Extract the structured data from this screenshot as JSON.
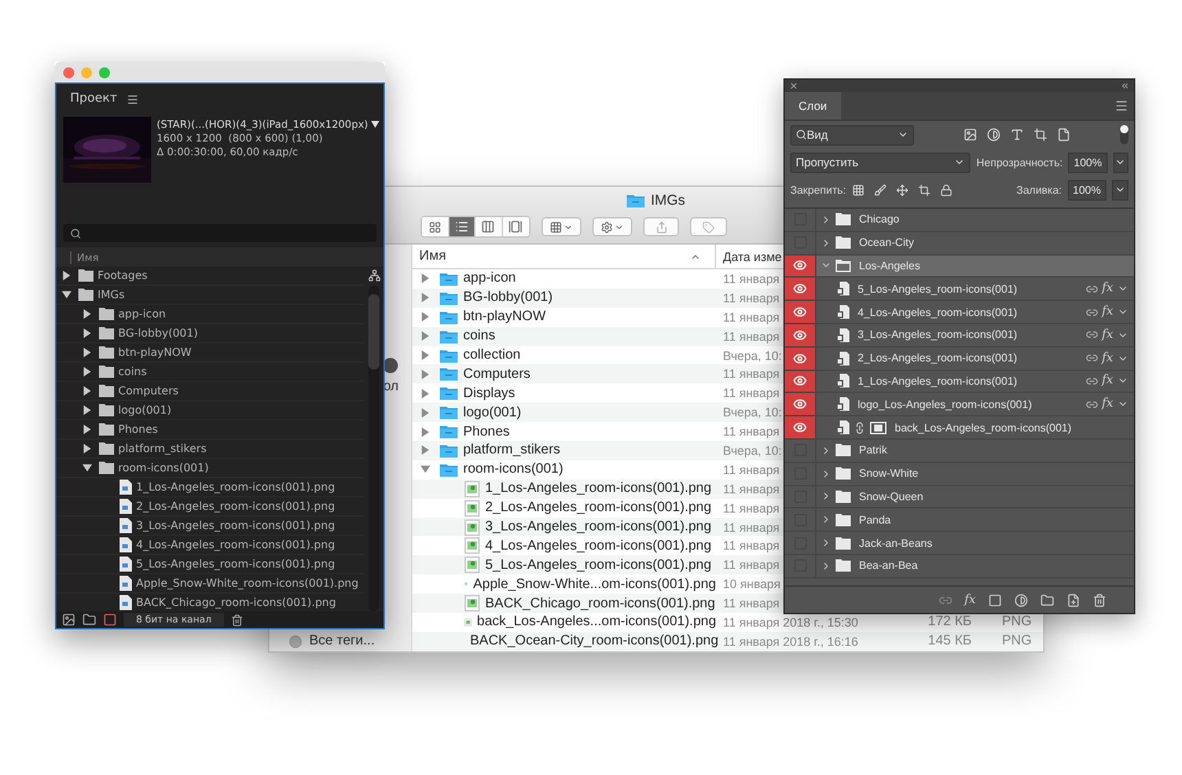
{
  "project_panel": {
    "title": "Проект",
    "comp": {
      "name": "(STAR)(...(HOR)(4_3)(iPad_1600x1200px)",
      "size": "1600 x 1200  (800 x 600) (1,00)",
      "duration": "Δ 0:00:30:00, 60,00 кадр/с"
    },
    "column": "Имя",
    "tree": [
      {
        "name": "Footages",
        "kind": "folder",
        "expanded": false
      },
      {
        "name": "IMGs",
        "kind": "folder",
        "expanded": true,
        "children": [
          {
            "name": "app-icon",
            "kind": "folder",
            "expanded": false
          },
          {
            "name": "BG-lobby(001)",
            "kind": "folder",
            "expanded": false
          },
          {
            "name": "btn-playNOW",
            "kind": "folder",
            "expanded": false
          },
          {
            "name": "coins",
            "kind": "folder",
            "expanded": false
          },
          {
            "name": "Computers",
            "kind": "folder",
            "expanded": false
          },
          {
            "name": "logo(001)",
            "kind": "folder",
            "expanded": false
          },
          {
            "name": "Phones",
            "kind": "folder",
            "expanded": false
          },
          {
            "name": "platform_stikers",
            "kind": "folder",
            "expanded": false
          },
          {
            "name": "room-icons(001)",
            "kind": "folder",
            "expanded": true,
            "children": [
              {
                "name": "1_Los-Angeles_room-icons(001).png",
                "kind": "file"
              },
              {
                "name": "2_Los-Angeles_room-icons(001).png",
                "kind": "file"
              },
              {
                "name": "3_Los-Angeles_room-icons(001).png",
                "kind": "file"
              },
              {
                "name": "4_Los-Angeles_room-icons(001).png",
                "kind": "file"
              },
              {
                "name": "5_Los-Angeles_room-icons(001).png",
                "kind": "file"
              },
              {
                "name": "Apple_Snow-White_room-icons(001).png",
                "kind": "file"
              },
              {
                "name": "BACK_Chicago_room-icons(001).png",
                "kind": "file"
              }
            ]
          }
        ]
      }
    ],
    "status": "8 бит на канал"
  },
  "finder": {
    "title": "IMGs",
    "view_modes": [
      {
        "kind": "icons",
        "selected": false
      },
      {
        "kind": "list",
        "selected": true
      },
      {
        "kind": "columns",
        "selected": false
      },
      {
        "kind": "cover",
        "selected": false
      }
    ],
    "sidebar": [
      "ол",
      "Все теги..."
    ],
    "columns": [
      "Имя",
      "Дата изме"
    ],
    "rows": [
      {
        "name": "app-icon",
        "kind": "folder",
        "expanded": false,
        "date": "11 января"
      },
      {
        "name": "BG-lobby(001)",
        "kind": "folder",
        "expanded": false,
        "date": "11 января"
      },
      {
        "name": "btn-playNOW",
        "kind": "folder",
        "expanded": false,
        "date": "11 января"
      },
      {
        "name": "coins",
        "kind": "folder",
        "expanded": false,
        "date": "11 января"
      },
      {
        "name": "collection",
        "kind": "folder",
        "expanded": false,
        "date": "Вчера, 10:"
      },
      {
        "name": "Computers",
        "kind": "folder",
        "expanded": false,
        "date": "11 января"
      },
      {
        "name": "Displays",
        "kind": "folder",
        "expanded": false,
        "date": "11 января"
      },
      {
        "name": "logo(001)",
        "kind": "folder",
        "expanded": false,
        "date": "Вчера, 10:"
      },
      {
        "name": "Phones",
        "kind": "folder",
        "expanded": false,
        "date": "11 января"
      },
      {
        "name": "platform_stikers",
        "kind": "folder",
        "expanded": false,
        "date": "Вчера, 10:"
      },
      {
        "name": "room-icons(001)",
        "kind": "folder",
        "expanded": true,
        "date": "11 января",
        "children": [
          {
            "name": "1_Los-Angeles_room-icons(001).png",
            "kind": "file",
            "date": "11 января"
          },
          {
            "name": "2_Los-Angeles_room-icons(001).png",
            "kind": "file",
            "date": "11 января"
          },
          {
            "name": "3_Los-Angeles_room-icons(001).png",
            "kind": "file",
            "date": "11 января"
          },
          {
            "name": "4_Los-Angeles_room-icons(001).png",
            "kind": "file",
            "date": "11 января"
          },
          {
            "name": "5_Los-Angeles_room-icons(001).png",
            "kind": "file",
            "date": "11 января"
          },
          {
            "name": "Apple_Snow-White...om-icons(001).png",
            "kind": "file",
            "date": "10 января"
          },
          {
            "name": "BACK_Chicago_room-icons(001).png",
            "kind": "file",
            "date": "11 января"
          },
          {
            "name": "back_Los-Angeles...om-icons(001).png",
            "kind": "file",
            "date": "11 января 2018 г., 15:30",
            "column_3": "172 КБ",
            "column_4": "PNG"
          },
          {
            "name": "BACK_Ocean-City_room-icons(001).png",
            "kind": "file",
            "date": "11 января 2018 г., 16:16",
            "column_3": "145 КБ",
            "column_4": "PNG"
          }
        ]
      }
    ]
  },
  "layers_panel": {
    "title": "Слои",
    "filter": "Вид",
    "blend": "Пропустить",
    "opacity_label": "Непрозрачность:",
    "opacity": "100%",
    "lock_label": "Закрепить:",
    "fill_label": "Заливка:",
    "fill": "100%",
    "toolbar_fx": "fx",
    "layers": [
      {
        "name": "Chicago",
        "kind": "group",
        "visible": false,
        "expanded": false,
        "selected": false
      },
      {
        "name": "Ocean-City",
        "kind": "group",
        "visible": false,
        "expanded": false,
        "selected": false
      },
      {
        "name": "Los-Angeles",
        "kind": "group",
        "visible": true,
        "expanded": true,
        "selected": true,
        "children": [
          {
            "name": "5_Los-Angeles_room-icons(001)",
            "kind": "fx_layer",
            "visible": true,
            "selected": false,
            "fx": "fx"
          },
          {
            "name": "4_Los-Angeles_room-icons(001)",
            "kind": "fx_layer",
            "visible": true,
            "selected": false,
            "fx": "fx"
          },
          {
            "name": "3_Los-Angeles_room-icons(001)",
            "kind": "fx_layer",
            "visible": true,
            "selected": false,
            "fx": "fx"
          },
          {
            "name": "2_Los-Angeles_room-icons(001)",
            "kind": "fx_layer",
            "visible": true,
            "selected": false,
            "fx": "fx"
          },
          {
            "name": "1_Los-Angeles_room-icons(001)",
            "kind": "fx_layer",
            "visible": true,
            "selected": false,
            "fx": "fx"
          },
          {
            "name": "logo_Los-Angeles_room-icons(001)",
            "kind": "fx_layer",
            "visible": true,
            "selected": false,
            "fx": "fx"
          },
          {
            "name": "back_Los-Angeles_room-icons(001)",
            "kind": "masked_layer",
            "visible": true,
            "selected": false
          }
        ]
      },
      {
        "name": "Patrik",
        "kind": "group",
        "visible": false,
        "expanded": false,
        "selected": false
      },
      {
        "name": "Snow-White",
        "kind": "group",
        "visible": false,
        "expanded": false,
        "selected": false
      },
      {
        "name": "Snow-Queen",
        "kind": "group",
        "visible": false,
        "expanded": false,
        "selected": false
      },
      {
        "name": "Panda",
        "kind": "group",
        "visible": false,
        "expanded": false,
        "selected": false
      },
      {
        "name": "Jack-an-Beans",
        "kind": "group",
        "visible": false,
        "expanded": false,
        "selected": false
      },
      {
        "name": "Bea-an-Bea",
        "kind": "group",
        "visible": false,
        "expanded": false,
        "selected": false
      }
    ]
  }
}
